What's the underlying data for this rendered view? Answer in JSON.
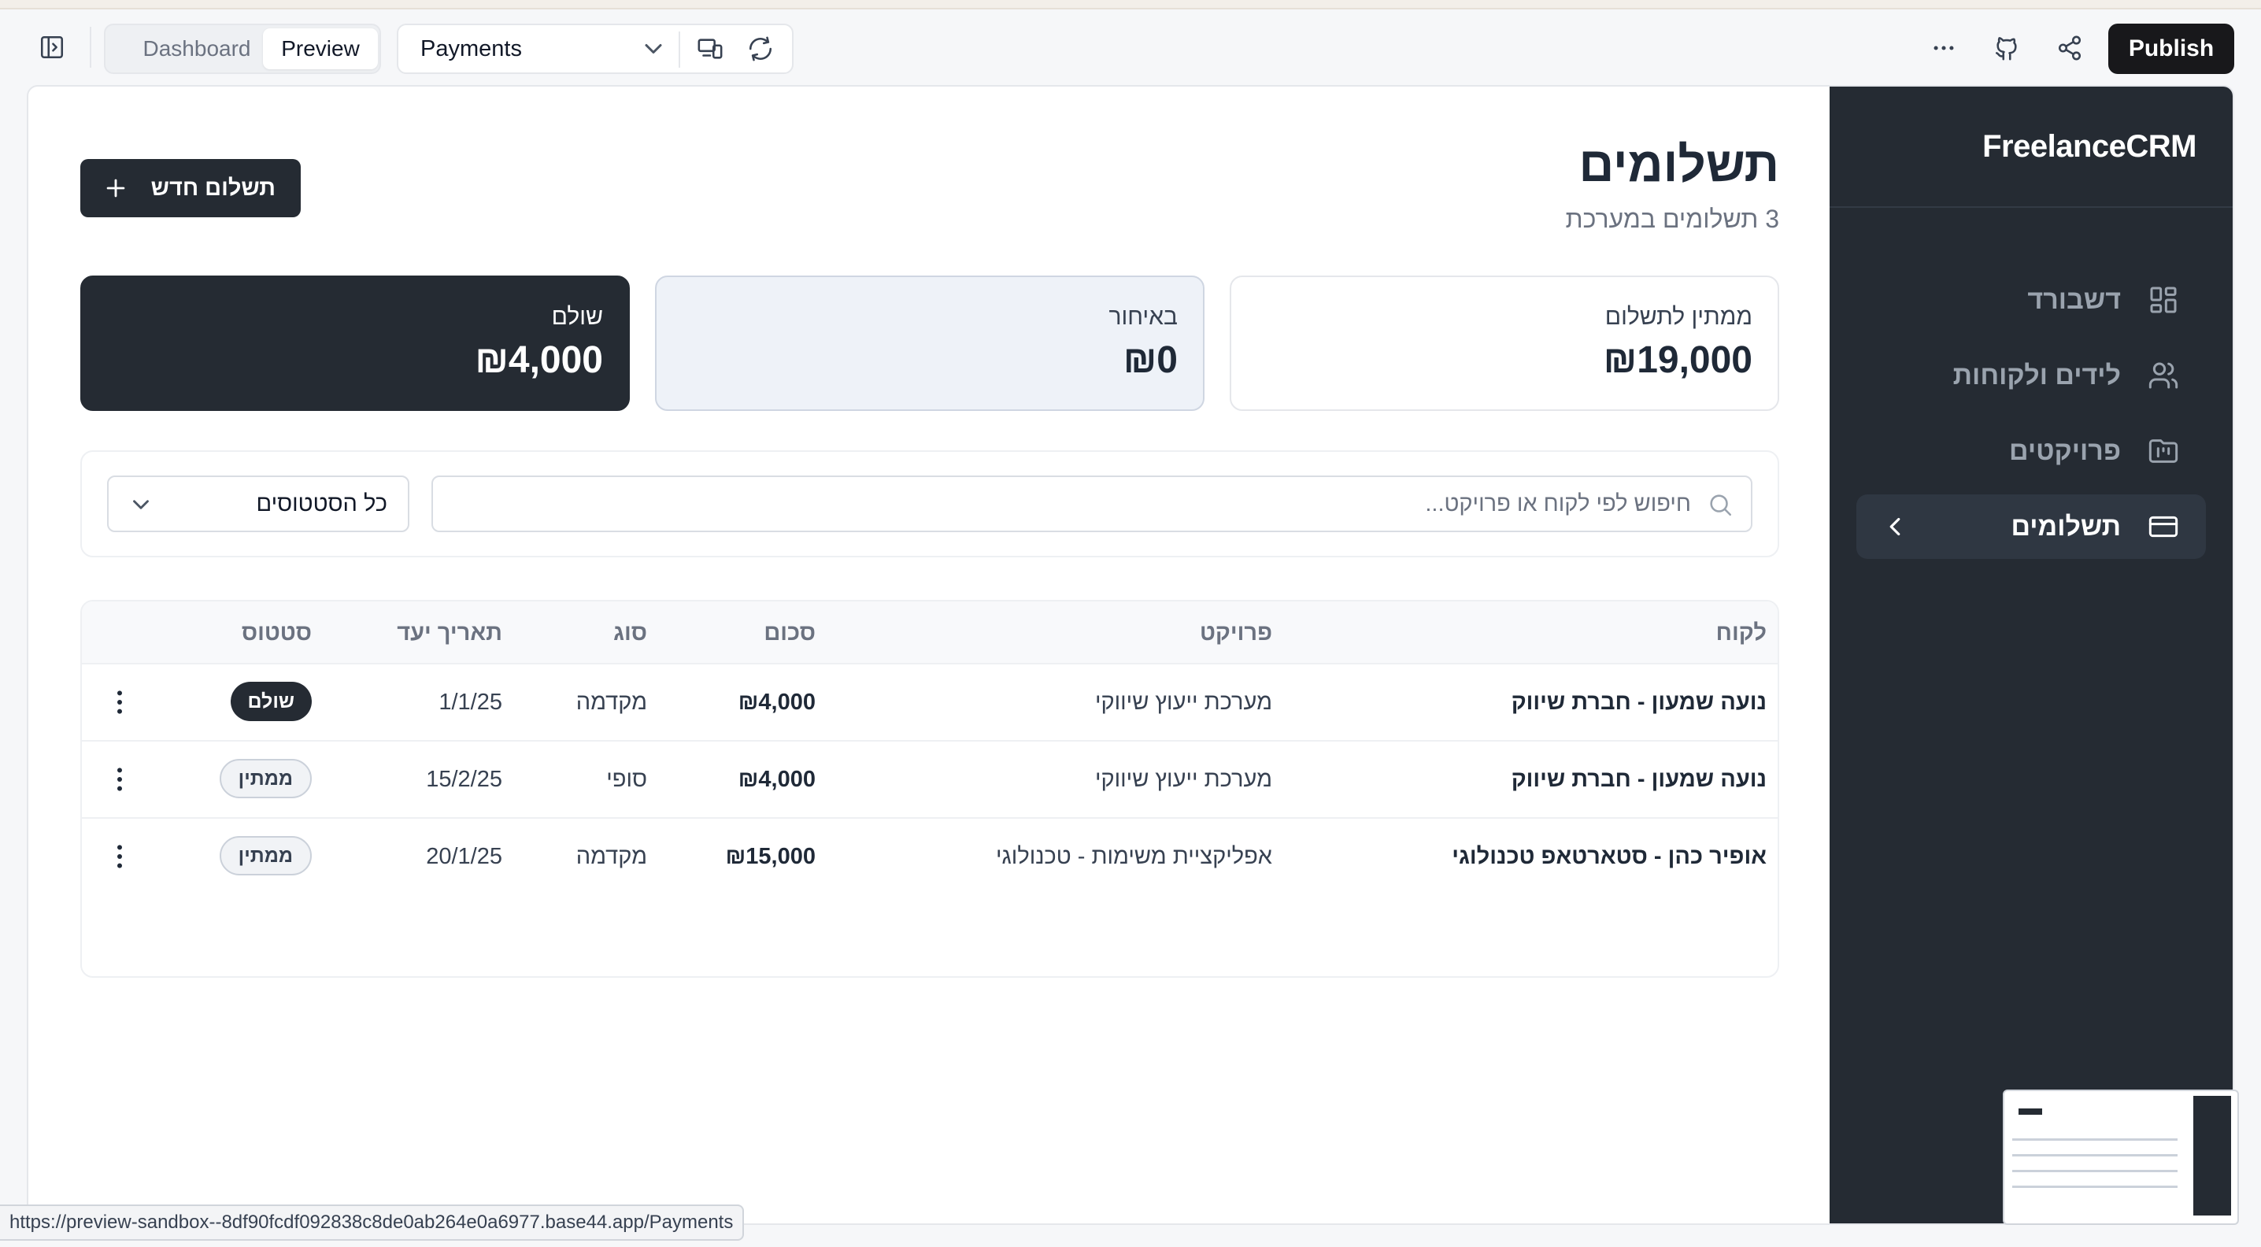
{
  "toolbar": {
    "tab_dashboard": "Dashboard",
    "tab_preview": "Preview",
    "page_select": "Payments",
    "publish_label": "Publish"
  },
  "sidebar": {
    "brand": "FreelanceCRM",
    "items": [
      {
        "label": "דשבורד",
        "icon": "layout-grid-icon"
      },
      {
        "label": "לידים ולקוחות",
        "icon": "users-icon"
      },
      {
        "label": "פרויקטים",
        "icon": "folder-kanban-icon"
      },
      {
        "label": "תשלומים",
        "icon": "credit-card-icon",
        "active": true
      }
    ]
  },
  "main": {
    "title": "תשלומים",
    "subtitle": "3 תשלומים במערכת",
    "new_button": "תשלום חדש"
  },
  "stats": [
    {
      "label": "ממתין לתשלום",
      "value": "₪19,000"
    },
    {
      "label": "באיחור",
      "value": "₪0"
    },
    {
      "label": "שולם",
      "value": "₪4,000"
    }
  ],
  "filters": {
    "search_placeholder": "חיפוש לפי לקוח או פרויקט...",
    "status_value": "כל הסטטוסים"
  },
  "table": {
    "headers": {
      "client": "לקוח",
      "project": "פרויקט",
      "amount": "סכום",
      "type": "סוג",
      "due_date": "תאריך יעד",
      "status": "סטטוס"
    },
    "rows": [
      {
        "client": "נועה שמעון - חברת שיווק",
        "project": "מערכת ייעוץ שיווקי",
        "amount": "₪4,000",
        "type": "מקדמה",
        "due_date": "1/1/25",
        "status": "שולם",
        "status_kind": "paid"
      },
      {
        "client": "נועה שמעון - חברת שיווק",
        "project": "מערכת ייעוץ שיווקי",
        "amount": "₪4,000",
        "type": "סופי",
        "due_date": "15/2/25",
        "status": "ממתין",
        "status_kind": "pending"
      },
      {
        "client": "אופיר כהן - סטארטאפ טכנולוגי",
        "project": "אפליקציית משימות - טכנולוגי",
        "amount": "₪15,000",
        "type": "מקדמה",
        "due_date": "20/1/25",
        "status": "ממתין",
        "status_kind": "pending"
      }
    ]
  },
  "statusbar": {
    "url": "https://preview-sandbox--8df90fcdf092838c8de0ab264e0a6977.base44.app/Payments"
  },
  "colors": {
    "sidebar_bg": "#252b33",
    "accent_dark": "#252b33",
    "publish_bg": "#18181b"
  }
}
